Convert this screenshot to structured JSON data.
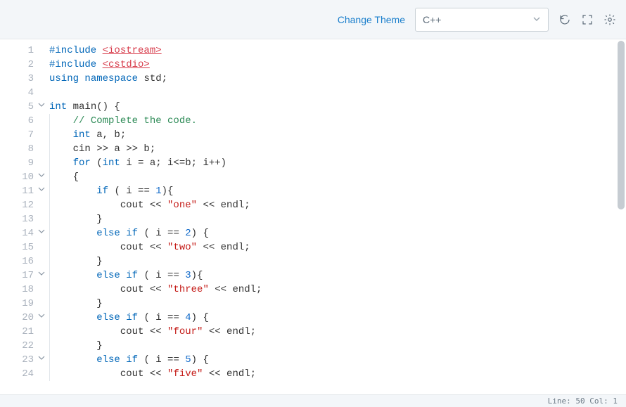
{
  "toolbar": {
    "change_theme_label": "Change Theme",
    "language_selected": "C++"
  },
  "status": {
    "line_col": "Line: 50 Col: 1"
  },
  "code": {
    "fold_lines": [
      5,
      10,
      11,
      14,
      17,
      20,
      23
    ],
    "lines": [
      {
        "n": 1,
        "tokens": [
          {
            "t": "#include ",
            "c": "blue"
          },
          {
            "t": "<iostream>",
            "c": "red-u"
          }
        ]
      },
      {
        "n": 2,
        "tokens": [
          {
            "t": "#include ",
            "c": "blue"
          },
          {
            "t": "<cstdio>",
            "c": "red-u"
          }
        ]
      },
      {
        "n": 3,
        "tokens": [
          {
            "t": "using ",
            "c": "blue"
          },
          {
            "t": "namespace ",
            "c": "blue"
          },
          {
            "t": "std;",
            "c": "plain"
          }
        ]
      },
      {
        "n": 4,
        "tokens": []
      },
      {
        "n": 5,
        "tokens": [
          {
            "t": "int ",
            "c": "blue"
          },
          {
            "t": "main",
            "c": "plain"
          },
          {
            "t": "() {",
            "c": "plain"
          }
        ]
      },
      {
        "n": 6,
        "indent": 1,
        "tokens": [
          {
            "t": "    ",
            "c": "plain"
          },
          {
            "t": "// Complete the code.",
            "c": "cmt"
          }
        ]
      },
      {
        "n": 7,
        "indent": 1,
        "tokens": [
          {
            "t": "    ",
            "c": "plain"
          },
          {
            "t": "int ",
            "c": "blue"
          },
          {
            "t": "a, b;",
            "c": "plain"
          }
        ]
      },
      {
        "n": 8,
        "indent": 1,
        "tokens": [
          {
            "t": "    cin >> a >> b;",
            "c": "plain"
          }
        ]
      },
      {
        "n": 9,
        "indent": 1,
        "tokens": [
          {
            "t": "    ",
            "c": "plain"
          },
          {
            "t": "for ",
            "c": "blue"
          },
          {
            "t": "(",
            "c": "plain"
          },
          {
            "t": "int ",
            "c": "blue"
          },
          {
            "t": "i = a; i<=b; i++)",
            "c": "plain"
          }
        ]
      },
      {
        "n": 10,
        "indent": 1,
        "tokens": [
          {
            "t": "    {",
            "c": "plain"
          }
        ]
      },
      {
        "n": 11,
        "indent": 2,
        "tokens": [
          {
            "t": "        ",
            "c": "plain"
          },
          {
            "t": "if ",
            "c": "blue"
          },
          {
            "t": "( i == ",
            "c": "plain"
          },
          {
            "t": "1",
            "c": "num"
          },
          {
            "t": "){",
            "c": "plain"
          }
        ]
      },
      {
        "n": 12,
        "indent": 3,
        "tokens": [
          {
            "t": "            cout << ",
            "c": "plain"
          },
          {
            "t": "\"one\"",
            "c": "str"
          },
          {
            "t": " << endl;",
            "c": "plain"
          }
        ]
      },
      {
        "n": 13,
        "indent": 2,
        "tokens": [
          {
            "t": "        }",
            "c": "plain"
          }
        ]
      },
      {
        "n": 14,
        "indent": 2,
        "tokens": [
          {
            "t": "        ",
            "c": "plain"
          },
          {
            "t": "else if ",
            "c": "blue"
          },
          {
            "t": "( i == ",
            "c": "plain"
          },
          {
            "t": "2",
            "c": "num"
          },
          {
            "t": ") {",
            "c": "plain"
          }
        ]
      },
      {
        "n": 15,
        "indent": 3,
        "tokens": [
          {
            "t": "            cout << ",
            "c": "plain"
          },
          {
            "t": "\"two\"",
            "c": "str"
          },
          {
            "t": " << endl;",
            "c": "plain"
          }
        ]
      },
      {
        "n": 16,
        "indent": 2,
        "tokens": [
          {
            "t": "        }",
            "c": "plain"
          }
        ]
      },
      {
        "n": 17,
        "indent": 2,
        "tokens": [
          {
            "t": "        ",
            "c": "plain"
          },
          {
            "t": "else if ",
            "c": "blue"
          },
          {
            "t": "( i == ",
            "c": "plain"
          },
          {
            "t": "3",
            "c": "num"
          },
          {
            "t": "){",
            "c": "plain"
          }
        ]
      },
      {
        "n": 18,
        "indent": 3,
        "tokens": [
          {
            "t": "            cout << ",
            "c": "plain"
          },
          {
            "t": "\"three\"",
            "c": "str"
          },
          {
            "t": " << endl;",
            "c": "plain"
          }
        ]
      },
      {
        "n": 19,
        "indent": 2,
        "tokens": [
          {
            "t": "        }",
            "c": "plain"
          }
        ]
      },
      {
        "n": 20,
        "indent": 2,
        "tokens": [
          {
            "t": "        ",
            "c": "plain"
          },
          {
            "t": "else if ",
            "c": "blue"
          },
          {
            "t": "( i == ",
            "c": "plain"
          },
          {
            "t": "4",
            "c": "num"
          },
          {
            "t": ") {",
            "c": "plain"
          }
        ]
      },
      {
        "n": 21,
        "indent": 3,
        "tokens": [
          {
            "t": "            cout << ",
            "c": "plain"
          },
          {
            "t": "\"four\"",
            "c": "str"
          },
          {
            "t": " << endl;",
            "c": "plain"
          }
        ]
      },
      {
        "n": 22,
        "indent": 2,
        "tokens": [
          {
            "t": "        }",
            "c": "plain"
          }
        ]
      },
      {
        "n": 23,
        "indent": 2,
        "tokens": [
          {
            "t": "        ",
            "c": "plain"
          },
          {
            "t": "else if ",
            "c": "blue"
          },
          {
            "t": "( i == ",
            "c": "plain"
          },
          {
            "t": "5",
            "c": "num"
          },
          {
            "t": ") {",
            "c": "plain"
          }
        ]
      },
      {
        "n": 24,
        "indent": 3,
        "tokens": [
          {
            "t": "            cout << ",
            "c": "plain"
          },
          {
            "t": "\"five\"",
            "c": "str"
          },
          {
            "t": " << endl;",
            "c": "plain"
          }
        ]
      }
    ]
  }
}
